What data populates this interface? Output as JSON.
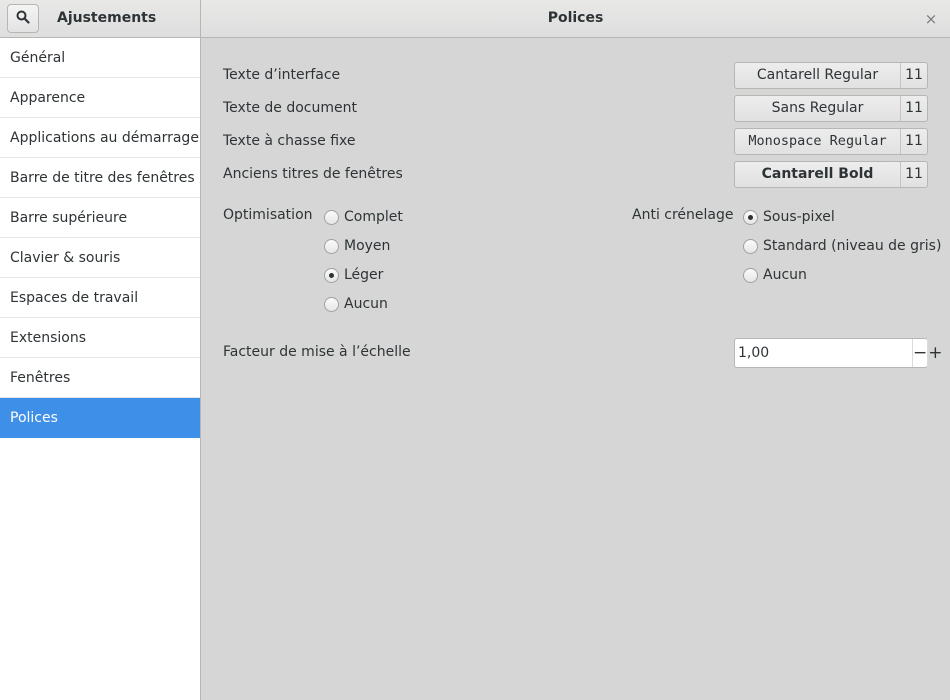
{
  "header": {
    "app_title": "Ajustements",
    "page_title": "Polices",
    "search_icon": "search-icon",
    "close_icon": "close-icon",
    "close_glyph": "×"
  },
  "sidebar": {
    "items": [
      {
        "label": "Général"
      },
      {
        "label": "Apparence"
      },
      {
        "label": "Applications au démarrage"
      },
      {
        "label": "Barre de titre des fenêtres"
      },
      {
        "label": "Barre supérieure"
      },
      {
        "label": "Clavier & souris"
      },
      {
        "label": "Espaces de travail"
      },
      {
        "label": "Extensions"
      },
      {
        "label": "Fenêtres"
      },
      {
        "label": "Polices",
        "active": true
      }
    ],
    "accent_color": "#3d8fe7"
  },
  "fonts": [
    {
      "label": "Texte d’interface",
      "font": "Cantarell Regular",
      "size": "11"
    },
    {
      "label": "Texte de document",
      "font": "Sans Regular",
      "size": "11"
    },
    {
      "label": "Texte à chasse fixe",
      "font": "Monospace Regular",
      "size": "11"
    },
    {
      "label": "Anciens titres de fenêtres",
      "font": "Cantarell Bold",
      "size": "11"
    }
  ],
  "hinting": {
    "label": "Optimisation",
    "options": [
      "Complet",
      "Moyen",
      "Léger",
      "Aucun"
    ],
    "selected": "Léger"
  },
  "antialiasing": {
    "label": "Anti crénelage",
    "options": [
      "Sous-pixel",
      "Standard (niveau de gris)",
      "Aucun"
    ],
    "selected": "Sous-pixel"
  },
  "scaling": {
    "label": "Facteur de mise à l’échelle",
    "value": "1,00",
    "minus_glyph": "−",
    "plus_glyph": "+"
  }
}
